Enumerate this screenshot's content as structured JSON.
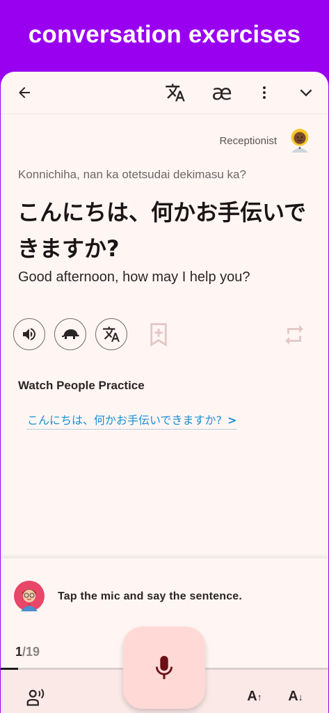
{
  "banner": {
    "title": "conversation exercises"
  },
  "toolbar": {
    "icons": [
      "back-arrow-icon",
      "translate-icon",
      "ae-phonetic-icon",
      "more-vert-icon",
      "chevron-down-icon"
    ],
    "ae_label": "æ"
  },
  "speaker": {
    "label": "Receptionist",
    "avatar": "receptionist-avatar"
  },
  "sentence": {
    "romaji": "Konnichiha, nan ka otetsudai dekimasu ka?",
    "japanese": "こんにちは、何かお手伝いできますか?",
    "english": "Good afternoon, how may I help you?"
  },
  "actions": [
    "speaker-icon",
    "turtle-icon",
    "translate-icon",
    "bookmark-add-icon",
    "repeat-icon"
  ],
  "watch": {
    "title": "Watch People Practice",
    "link": "こんにちは、何かお手伝いできますか?",
    "arrow": ">"
  },
  "coach": {
    "text": "Tap the mic and say the sentence."
  },
  "progress": {
    "current": "1",
    "total": "/19",
    "fraction": 0.0526
  },
  "colors": {
    "banner": "#9a00f0",
    "card": "#fff6f4",
    "link": "#1a8fd6",
    "mic_bg": "#ffd9d5",
    "mic": "#6b0f15"
  },
  "footer": {
    "icons": [
      "voice-person-icon",
      "font-increase-icon",
      "font-decrease-icon"
    ],
    "increase_label": "A",
    "decrease_label": "A"
  }
}
